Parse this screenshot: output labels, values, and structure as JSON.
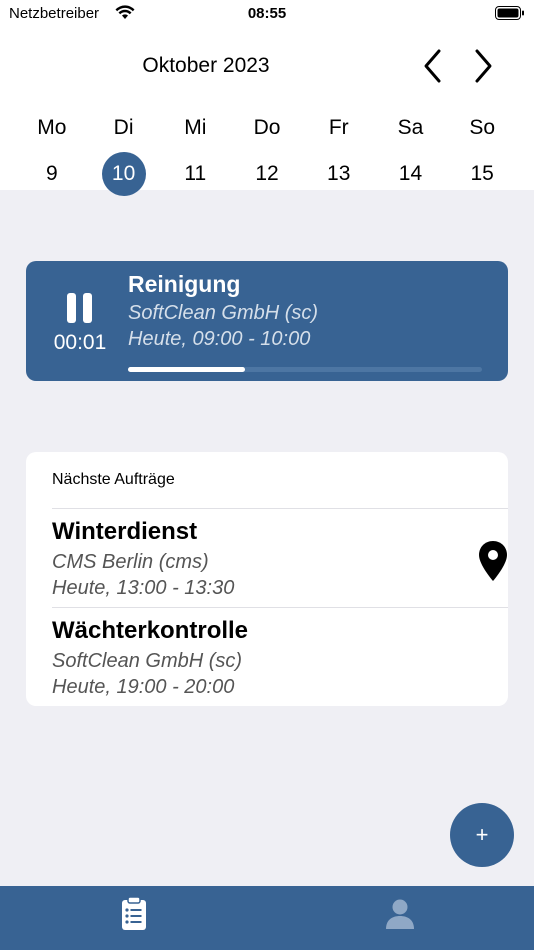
{
  "status_bar": {
    "carrier": "Netzbetreiber",
    "time": "08:55"
  },
  "calendar": {
    "month": "Oktober 2023",
    "days": [
      {
        "name": "Mo",
        "num": "9"
      },
      {
        "name": "Di",
        "num": "10"
      },
      {
        "name": "Mi",
        "num": "11"
      },
      {
        "name": "Do",
        "num": "12"
      },
      {
        "name": "Fr",
        "num": "13"
      },
      {
        "name": "Sa",
        "num": "14"
      },
      {
        "name": "So",
        "num": "15"
      }
    ],
    "selected_day": "10"
  },
  "active_job": {
    "title": "Reinigung",
    "company": "SoftClean GmbH (sc)",
    "time": "Heute, 09:00 - 10:00",
    "timer": "00:01",
    "progress_fraction": 0.33
  },
  "next_jobs": {
    "header": "Nächste Aufträge",
    "items": [
      {
        "title": "Winterdienst",
        "company": "CMS Berlin (cms)",
        "time": "Heute, 13:00 - 13:30",
        "icon": "map-pin-icon"
      },
      {
        "title": "Wächterkontrolle",
        "company": "SoftClean GmbH (sc)",
        "time": "Heute, 19:00 - 20:00"
      }
    ]
  },
  "fab": {
    "label": "+"
  },
  "colors": {
    "accent": "#386393",
    "background": "#efeff4",
    "progress_track": "#4d76a3"
  },
  "tabs": [
    {
      "icon": "clipboard-icon",
      "active": true
    },
    {
      "icon": "person-icon",
      "active": false
    }
  ]
}
